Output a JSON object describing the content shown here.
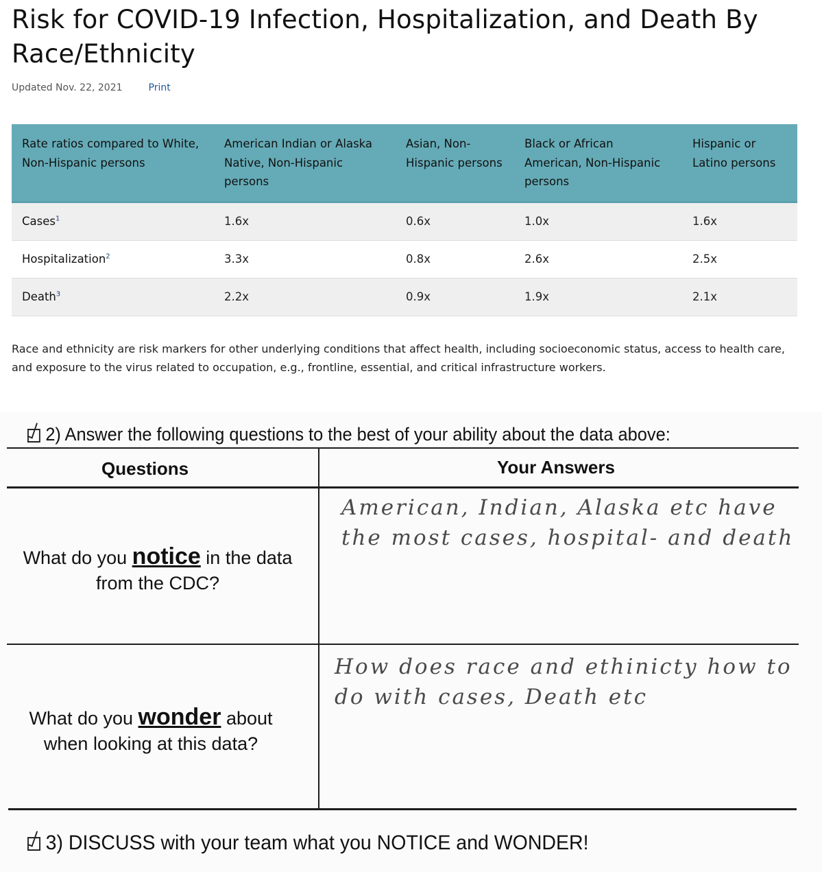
{
  "header": {
    "title": "Risk for COVID-19 Infection, Hospitalization, and Death By Race/Ethnicity",
    "updated": "Updated Nov. 22, 2021",
    "print_label": "Print"
  },
  "table": {
    "columns": [
      "Rate ratios compared to White, Non-Hispanic persons",
      "American Indian or Alaska Native, Non-Hispanic persons",
      "Asian, Non-Hispanic persons",
      "Black or African American, Non-Hispanic persons",
      "Hispanic or Latino persons"
    ],
    "rows": [
      {
        "label": "Cases",
        "footnote": "1",
        "values": [
          "1.6x",
          "0.6x",
          "1.0x",
          "1.6x"
        ]
      },
      {
        "label": "Hospitalization",
        "footnote": "2",
        "values": [
          "3.3x",
          "0.8x",
          "2.6x",
          "2.5x"
        ]
      },
      {
        "label": "Death",
        "footnote": "3",
        "values": [
          "2.2x",
          "0.9x",
          "1.9x",
          "2.1x"
        ]
      }
    ],
    "header_color": "#65abb7"
  },
  "note": "Race and ethnicity are risk markers for other underlying conditions that affect health, including socioeconomic status, access to health care, and exposure to the virus related to occupation, e.g., frontline, essential, and critical infrastructure workers.",
  "worksheet": {
    "section2_title": "2) Answer the following questions to the best of your ability about the data above:",
    "col_questions": "Questions",
    "col_answers": "Your Answers",
    "q1": {
      "pre": "What do you ",
      "key": "notice",
      "post": " in the data from the CDC?"
    },
    "a1": "American, Indian, Alaska etc have the most cases, hospital- and death",
    "q2": {
      "pre": "What do you ",
      "key": "wonder",
      "post": " about when looking at this data?"
    },
    "a2": "How does race and ethinicty how to do with cases, Death etc",
    "section3_title": "3) DISCUSS with your team what you NOTICE and WONDER!"
  }
}
